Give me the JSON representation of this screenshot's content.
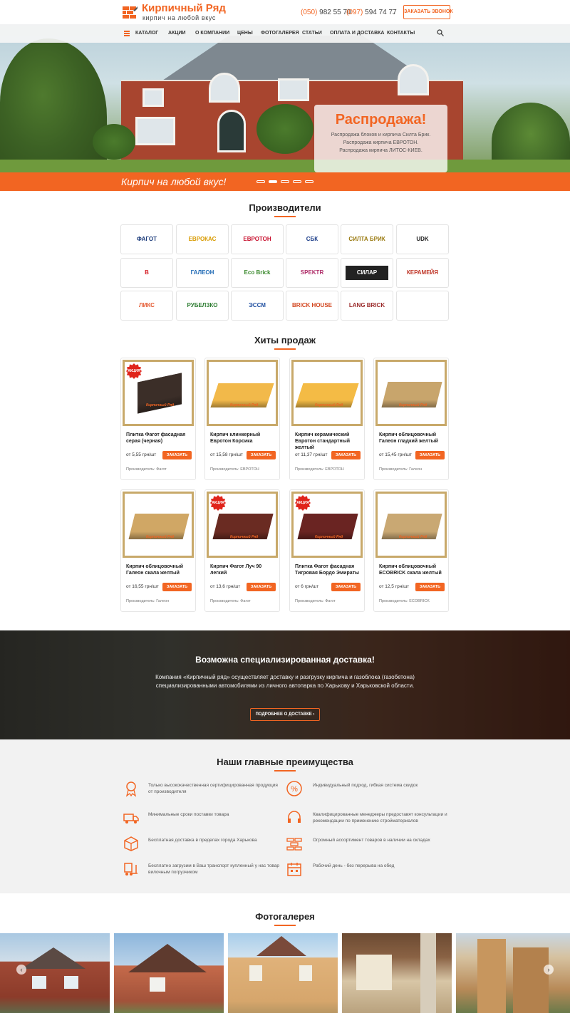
{
  "header": {
    "logo_title": "Кирпичный Ряд",
    "logo_subtitle": "кирпич на любой вкус",
    "phone1_code": "(050)",
    "phone1_number": "982 55 70",
    "phone2_code": "(097)",
    "phone2_number": "594 74 77",
    "callback_label": "ЗАКАЗАТЬ ЗВОНОК"
  },
  "nav": {
    "items": [
      "КАТАЛОГ",
      "АКЦИИ",
      "О КОМПАНИИ",
      "ЦЕНЫ",
      "ФОТОГАЛЕРЕЯ",
      "СТАТЬИ",
      "ОПЛАТА И ДОСТАВКА",
      "КОНТАКТЫ"
    ]
  },
  "hero": {
    "sale_title": "Распродажа!",
    "sale_lines": [
      "Распродажа блоков и кирпича Силта Брик.",
      "Распродажа кирпича ЕВРОТОН.",
      "Распродажа кирпича ЛИТОС-КИЕВ."
    ],
    "slogan": "Кирпич на любой вкус!"
  },
  "producers": {
    "title": "Производители",
    "brands": [
      {
        "name": "ФАГОТ",
        "color": "#1a3a7a"
      },
      {
        "name": "ЕВРОКАС",
        "color": "#d89a00"
      },
      {
        "name": "ЕВРОТОН",
        "color": "#c8102e"
      },
      {
        "name": "СБК",
        "color": "#1e3f8a"
      },
      {
        "name": "СИЛТА БРИК",
        "color": "#9a7a10"
      },
      {
        "name": "UDK",
        "color": "#222222"
      },
      {
        "name": "В",
        "color": "#d51f26"
      },
      {
        "name": "ГАЛЕОН",
        "color": "#1f6ab5"
      },
      {
        "name": "Eco Brick",
        "color": "#3b8a2e"
      },
      {
        "name": "SPEKTR",
        "color": "#b0306b"
      },
      {
        "name": "СИЛАР",
        "color": "#ffffff"
      },
      {
        "name": "КЕРАМЕЙЯ",
        "color": "#c0392b"
      },
      {
        "name": "ЛИКС",
        "color": "#e4572e"
      },
      {
        "name": "РУБЕЛЗКО",
        "color": "#2e7d32"
      },
      {
        "name": "ЭССМ",
        "color": "#1f4fa0"
      },
      {
        "name": "BRICK HOUSE",
        "color": "#d2461f"
      },
      {
        "name": "LANG BRICK",
        "color": "#9a2a2a"
      }
    ]
  },
  "hits": {
    "title": "Хиты продаж",
    "order_label": "ЗАКАЗАТЬ",
    "badge_label": "АКЦИЯ",
    "watermark": "Кирпичный Ряд",
    "products": [
      {
        "name": "Плитка Фагот фасадная серая (черная)",
        "price": "от 5,55 грн/шт",
        "maker": "Производитель: Фагот",
        "badge": true,
        "brick_color": "#3b2e28"
      },
      {
        "name": "Кирпич клинкерный Евротон Корсика",
        "price": "от 15,58 грн/шт",
        "maker": "Производитель: ЕВРОТОН",
        "badge": false,
        "brick_color": "#f2b94a"
      },
      {
        "name": "Кирпич керамический Евротон стандартный желтый",
        "price": "от 11,37 грн/шт",
        "maker": "Производитель: ЕВРОТОН",
        "badge": false,
        "brick_color": "#f4bb45"
      },
      {
        "name": "Кирпич облицовочный Галеон гладкий желтый",
        "price": "от 15,45 грн/шт",
        "maker": "Производитель: Галеон",
        "badge": false,
        "brick_color": "#c8a56c"
      },
      {
        "name": "Кирпич облицовочный Галеон скала желтый",
        "price": "от 16,55 грн/шт",
        "maker": "Производитель: Галеон",
        "badge": false,
        "brick_color": "#d0a765"
      },
      {
        "name": "Кирпич Фагот Луч 90 легкий",
        "price": "от 13,6 грн/шт",
        "maker": "Производитель: Фагот",
        "badge": true,
        "brick_color": "#6a2b22"
      },
      {
        "name": "Плитка Фагот фасадная Тигровая Бордо Эмираты",
        "price": "от 6 грн/шт",
        "maker": "Производитель: Фагот",
        "badge": true,
        "brick_color": "#6a2422"
      },
      {
        "name": "Кирпич облицовочный ECOBRICK скала желтый",
        "price": "от 12,5 грн/шт",
        "maker": "Производитель: ECOBRICK",
        "badge": false,
        "brick_color": "#c9a873"
      }
    ]
  },
  "delivery": {
    "title": "Возможна специализированная доставка!",
    "text": "Компания «Кирпичный ряд» осуществляет доставку и разгрузку кирпича и газоблока (газобетона) специализированными автомобилями из личного автопарка по Харькову и Харьковской области.",
    "button_label": "ПОДРОБНЕЕ О ДОСТАВКЕ ›"
  },
  "advantages": {
    "title": "Наши главные преимущества",
    "items": [
      {
        "icon": "certificate-icon",
        "text": "Только высококачественная сертифицированная продукция от производителя"
      },
      {
        "icon": "percent-icon",
        "text": "Индивидуальный подход, гибкая система скидок"
      },
      {
        "icon": "truck-icon",
        "text": "Минимальные сроки поставки товара"
      },
      {
        "icon": "headset-icon",
        "text": "Квалифицированные менеджеры предоставят консультации и рекомендации по применению стройматериалов"
      },
      {
        "icon": "box-icon",
        "text": "Бесплатная доставка в пределах города Харькова"
      },
      {
        "icon": "bricks-icon",
        "text": "Огромный ассортимент товаров в наличии на складах"
      },
      {
        "icon": "forklift-icon",
        "text": "Бесплатно загрузим в Ваш транспорт купленный у нас товар вилочным погрузчиком"
      },
      {
        "icon": "calendar-icon",
        "text": "Рабочий день - без перерыва на обед"
      }
    ]
  },
  "gallery": {
    "title": "Фотогалерея",
    "prev": "‹",
    "next": "›"
  },
  "colors": {
    "accent": "#f26522",
    "frame": "#c8a96a"
  }
}
